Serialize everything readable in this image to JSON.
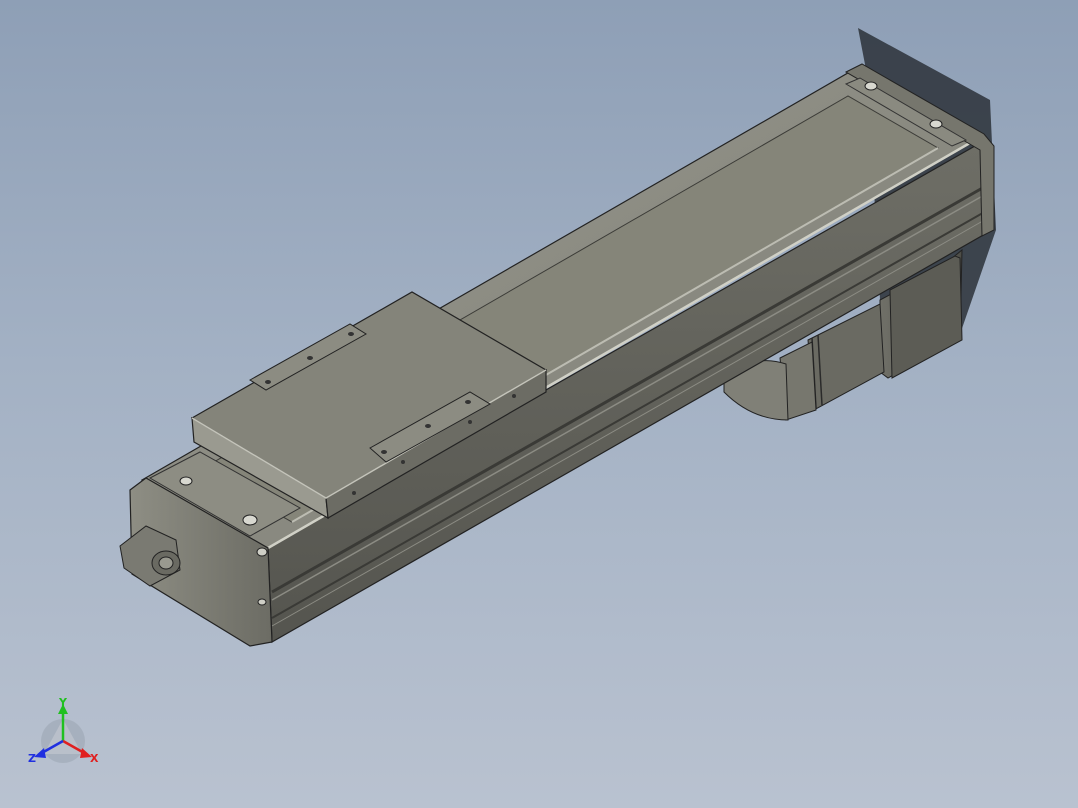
{
  "viewport": {
    "background_top": "#8e9fb6",
    "background_bottom": "#b9c2d0"
  },
  "model": {
    "body_color": "#8a8a80",
    "shadow_color": "#2c3138"
  },
  "triad": {
    "x_label": "X",
    "y_label": "Y",
    "z_label": "Z",
    "x_color": "#e02020",
    "y_color": "#20c020",
    "z_color": "#2030e0"
  }
}
